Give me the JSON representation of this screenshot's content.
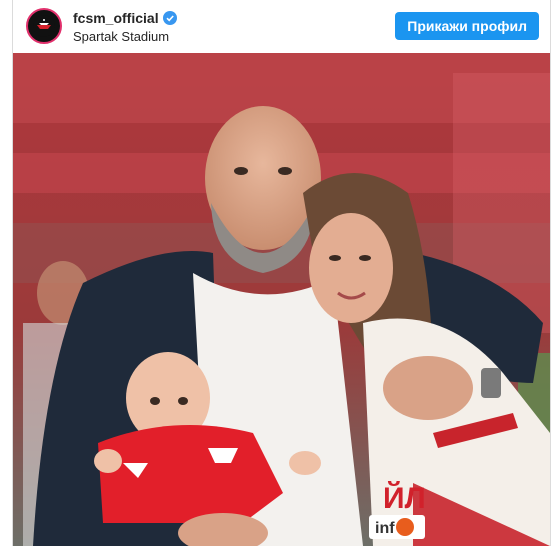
{
  "post": {
    "username": "fcsm_official",
    "location": "Spartak Stadium",
    "profile_button": "Прикажи профил",
    "avatar_icon": "spartak-logo-icon",
    "verified_icon": "verified-badge-icon",
    "verified_color": "#3897f0",
    "button_color": "#1b95f0"
  },
  "photo": {
    "shirt_text": "ЙЛ",
    "sponsor_text": "inf"
  }
}
